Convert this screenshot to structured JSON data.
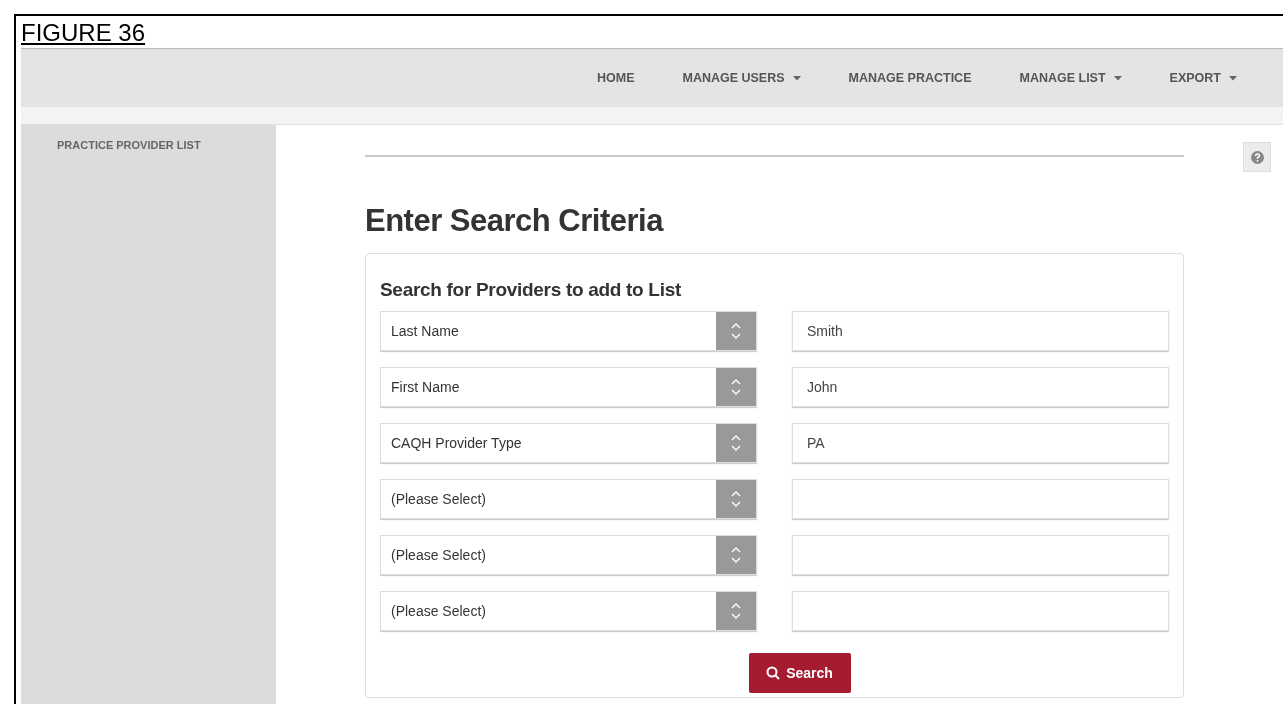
{
  "figure_title": "FIGURE 36",
  "nav": [
    {
      "label": "HOME",
      "dropdown": false
    },
    {
      "label": "MANAGE USERS",
      "dropdown": true
    },
    {
      "label": "MANAGE PRACTICE",
      "dropdown": false
    },
    {
      "label": "MANAGE LIST",
      "dropdown": true
    },
    {
      "label": "EXPORT",
      "dropdown": true
    }
  ],
  "sidebar": {
    "items": [
      "PRACTICE PROVIDER LIST"
    ]
  },
  "heading": "Enter Search Criteria",
  "card": {
    "title": "Search for Providers to add to List",
    "rows": [
      {
        "field": "Last Name",
        "value": "Smith"
      },
      {
        "field": "First Name",
        "value": "John"
      },
      {
        "field": "CAQH Provider Type",
        "value": "PA"
      },
      {
        "field": "(Please Select)"
      },
      {
        "field": "(Please Select)"
      },
      {
        "field": "(Please Select)"
      }
    ],
    "button": "Search"
  }
}
